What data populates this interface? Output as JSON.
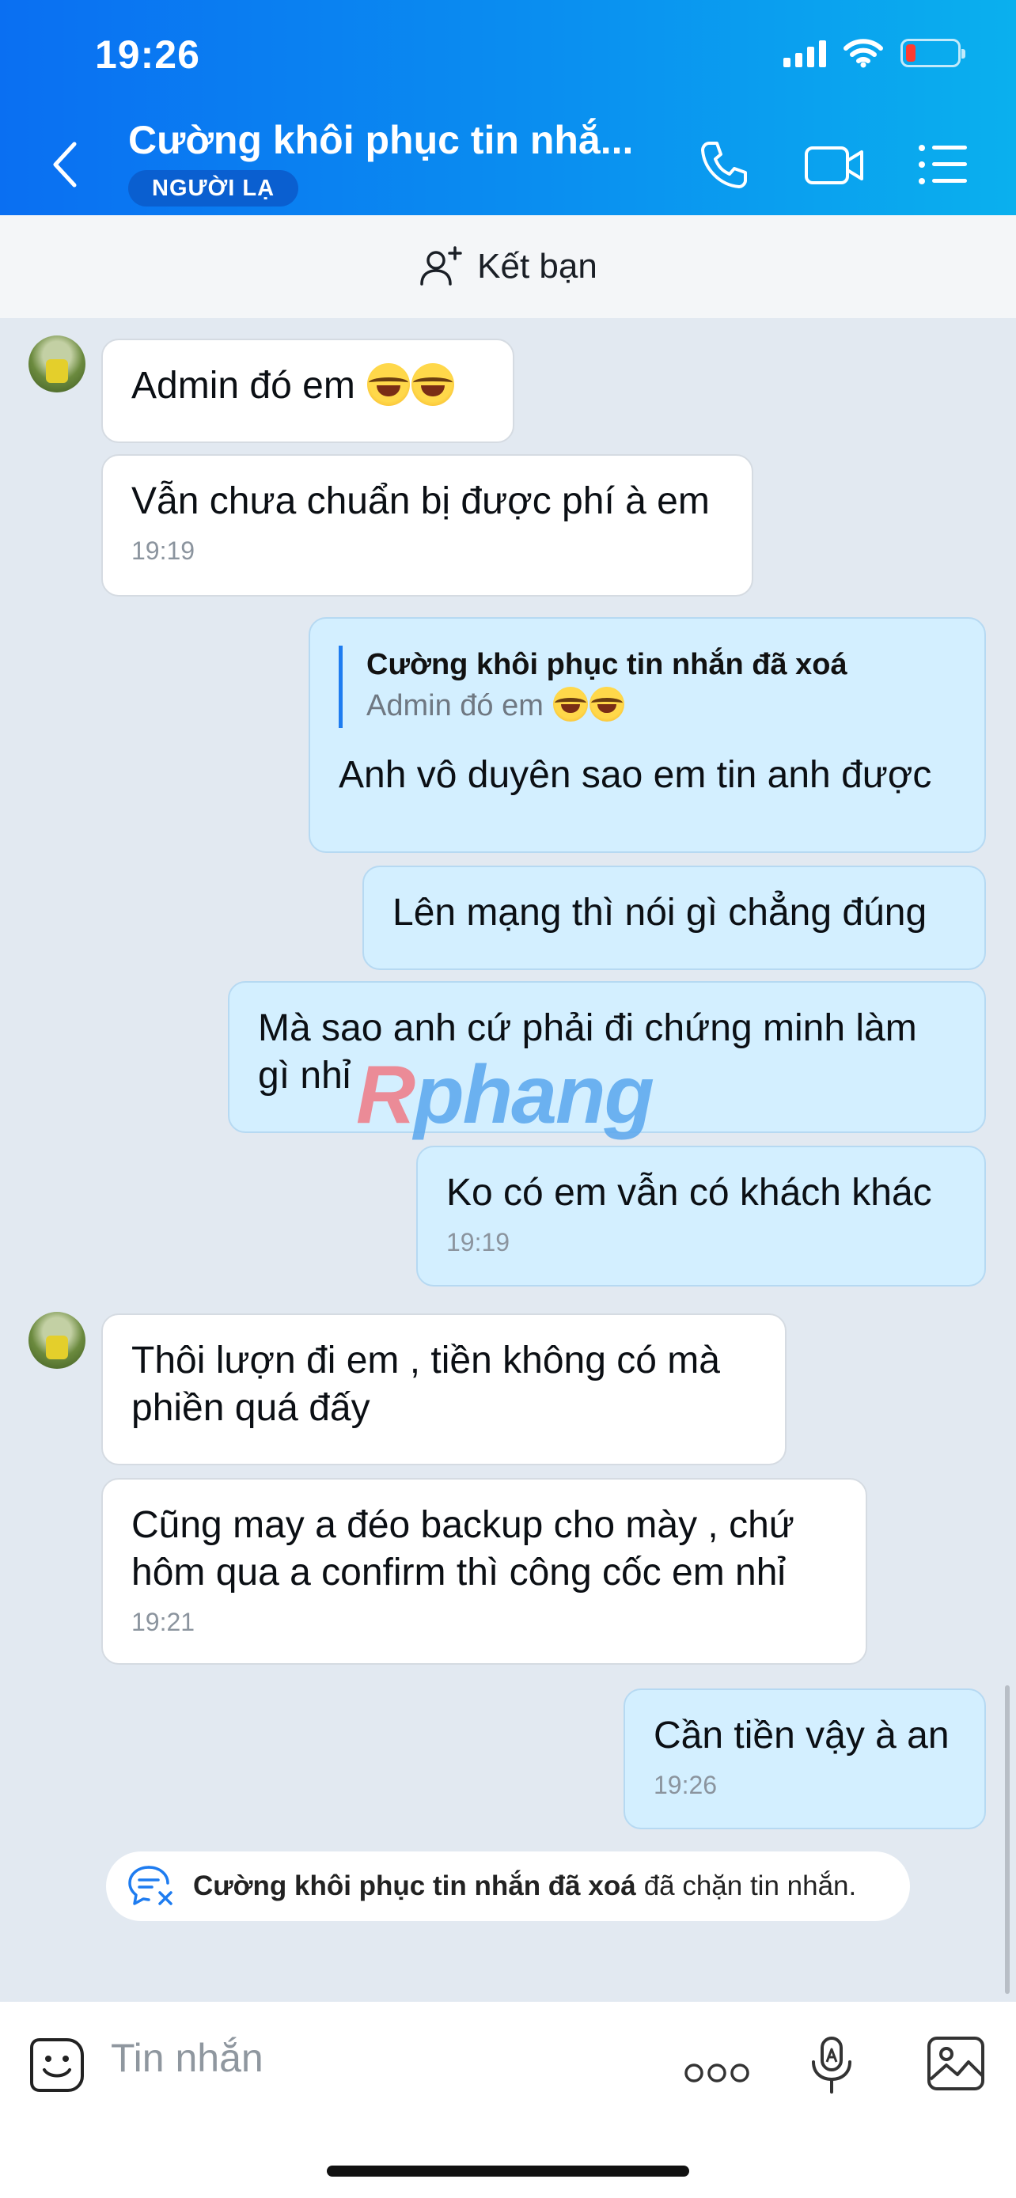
{
  "status_bar": {
    "time": "19:26"
  },
  "header": {
    "title": "Cường khôi phục tin nhắ...",
    "badge": "NGƯỜI LẠ",
    "icons": [
      "back-icon",
      "phone-icon",
      "video-icon",
      "menu-icon"
    ]
  },
  "add_friend": {
    "label": "Kết bạn"
  },
  "messages": [
    {
      "dir": "in",
      "text": "Admin đó em"
    },
    {
      "dir": "in",
      "text": "Vẫn chưa chuẩn bị được phí à em",
      "time": "19:19"
    },
    {
      "dir": "out",
      "reply_name": "Cường khôi phục tin nhắn đã xoá",
      "reply_text": "Admin đó em",
      "text": "Anh vô duyên sao em tin anh được"
    },
    {
      "dir": "out",
      "text": "Lên mạng thì nói gì chẳng đúng"
    },
    {
      "dir": "out",
      "line1": "Mà sao anh cứ phải đi chứng minh làm",
      "line2": "gì nhỉ"
    },
    {
      "dir": "out",
      "text": "Ko có em vẫn có khách khác",
      "time": "19:19"
    },
    {
      "dir": "in",
      "line1": "Thôi lượn đi em , tiền không có mà",
      "line2": "phiền quá đấy"
    },
    {
      "dir": "in",
      "line1": "Cũng may a đéo backup cho mày , chứ",
      "line2": "hôm qua a confirm thì công cốc em nhỉ",
      "time": "19:21"
    },
    {
      "dir": "out",
      "text": "Cần tiền vậy à an",
      "time": "19:26"
    }
  ],
  "system_notice": {
    "name": "Cường khôi phục tin nhắn đã xoá",
    "text": "đã chặn tin nhắn."
  },
  "watermark": {
    "text": "Rphang"
  },
  "input": {
    "placeholder": "Tin nhắn"
  },
  "colors": {
    "header_blue": "#0a7ff1",
    "out_bubble": "#d3efff",
    "in_bubble": "#ffffff",
    "chat_bg": "#e2e9f1"
  }
}
